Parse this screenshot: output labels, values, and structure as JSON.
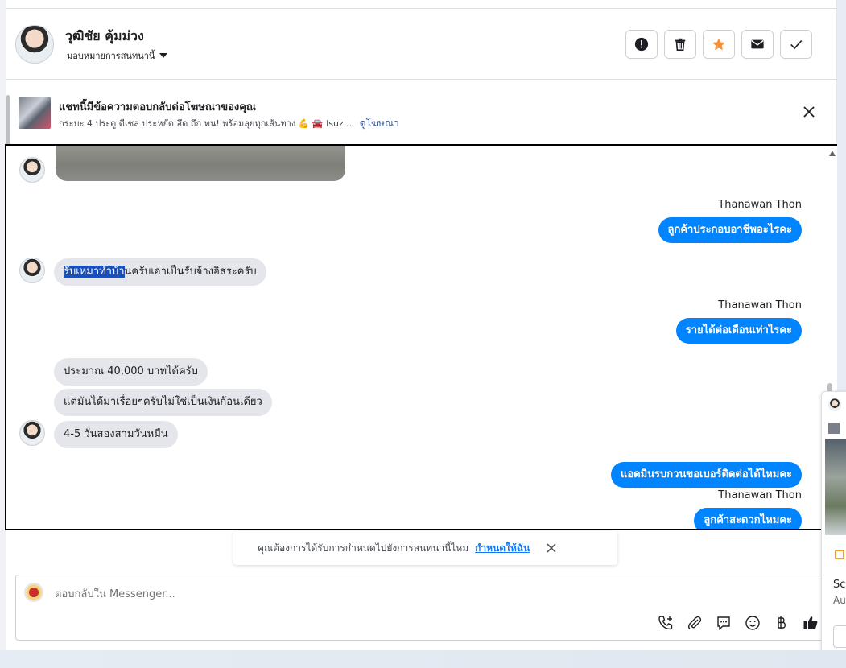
{
  "header": {
    "contact_name": "วุฒิชัย คุ้มม่วง",
    "assign_label": "มอบหมายการสนทนานี้"
  },
  "ad": {
    "title": "แชทนี้มีข้อความตอบกลับต่อโฆษณาของคุณ",
    "subtitle": "กระบะ 4 ประตู ดีเซล ประหยัด อึด ถึก ทน! พร้อมลุยทุกเส้นทาง 💪 🚘 Isuz...",
    "link": "ดูโฆษณา"
  },
  "messages": {
    "sender1": "Thanawan Thon",
    "out1": "ลูกค้าประกอบอาชีพอะไรคะ",
    "in1_highlight": "รับเหมาทำบ้า",
    "in1_rest": "นครับเอาเป็นรับจ้างอิสระครับ",
    "sender2": "Thanawan Thon",
    "out2": "รายได้ต่อเดือนเท่าไรคะ",
    "in2": "ประมาณ 40,000 บาทได้ครับ",
    "in3": "แต่มันได้มาเรื่อยๆครับไม่ใช่เป็นเงินก้อนเดียว",
    "in4": "4-5 วันสองสามวันหมื่น",
    "out3": "แอดมินรบกวนขอเบอร์ติดต่อได้ไหมคะ",
    "sender3": "Thanawan Thon",
    "out4": "ลูกค้าสะดวกไหมคะ"
  },
  "notice": {
    "text": "คุณต้องการได้รับการกำหนดไปยังการสนทนานี้ไหม",
    "link": "กำหนดให้ฉัน"
  },
  "composer": {
    "placeholder": "ตอบกลับใน Messenger..."
  },
  "side": {
    "text1": "Sc",
    "text2": "Au"
  },
  "colors": {
    "accent": "#0084ff",
    "star": "#f7923a",
    "link": "#385898"
  }
}
